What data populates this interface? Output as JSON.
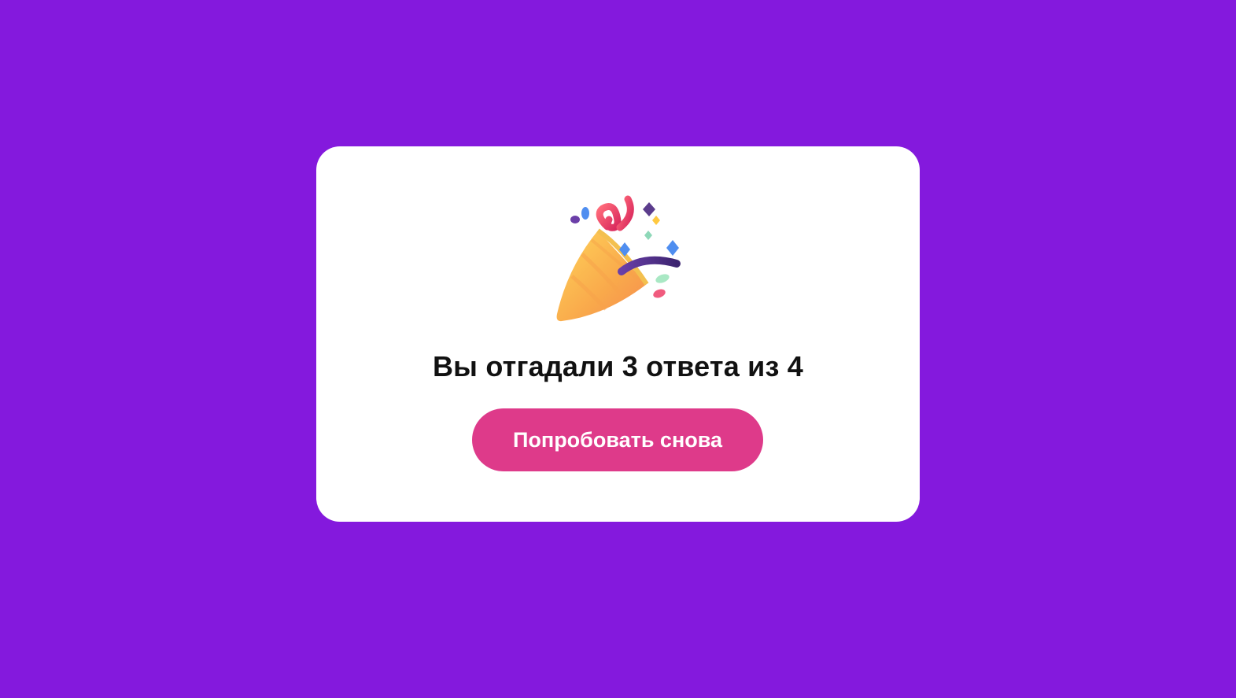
{
  "colors": {
    "background": "#8419dd",
    "card": "#ffffff",
    "accent": "#de3a8a",
    "title_text": "#111111",
    "button_text": "#ffffff"
  },
  "result": {
    "icon": "party-popper-icon",
    "title": "Вы отгадали 3 ответа из 4",
    "correct": 3,
    "total": 4
  },
  "actions": {
    "retry_label": "Попробовать снова"
  }
}
